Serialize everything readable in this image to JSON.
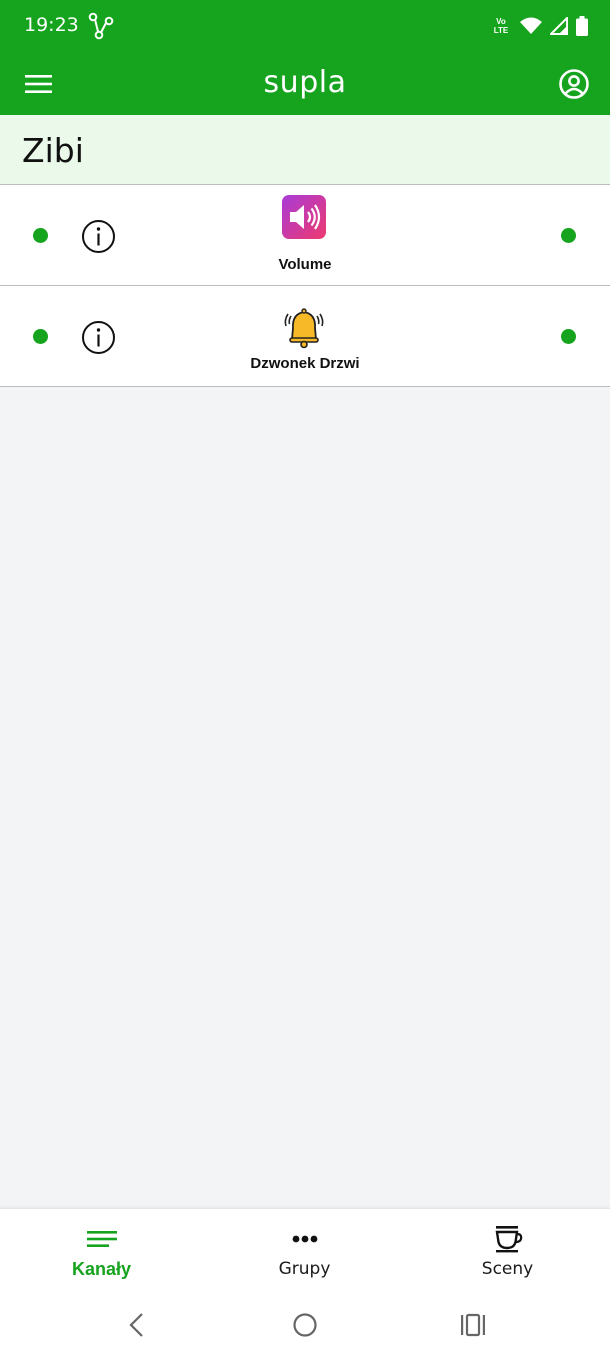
{
  "status_bar": {
    "time": "19:23",
    "volte_top": "Vo",
    "volte_bottom": "LTE",
    "icons": [
      "branch-icon",
      "volte-icon",
      "wifi-icon",
      "signal-icon",
      "battery-icon"
    ]
  },
  "app_bar": {
    "title": "supla",
    "icons": [
      "hamburger-menu-icon",
      "account-icon"
    ]
  },
  "location": {
    "name": "Zibi"
  },
  "channels": [
    {
      "label": "Volume",
      "icon": "speaker-icon",
      "status_left": "online",
      "status_right": "online"
    },
    {
      "label": "Dzwonek Drzwi",
      "icon": "bell-icon",
      "status_left": "online",
      "status_right": "online"
    }
  ],
  "bottom_nav": {
    "tabs": [
      {
        "label": "Kanały",
        "icon": "list-icon",
        "active": true
      },
      {
        "label": "Grupy",
        "icon": "dots-icon",
        "active": false
      },
      {
        "label": "Sceny",
        "icon": "cup-icon",
        "active": false
      }
    ]
  },
  "system_nav": {
    "buttons": [
      "back-icon",
      "home-icon",
      "recents-icon"
    ]
  },
  "colors": {
    "brand": "#16a41e",
    "location_bg": "#eaf9ea",
    "content_bg": "#f3f4f6",
    "status_online": "#16a41e"
  }
}
